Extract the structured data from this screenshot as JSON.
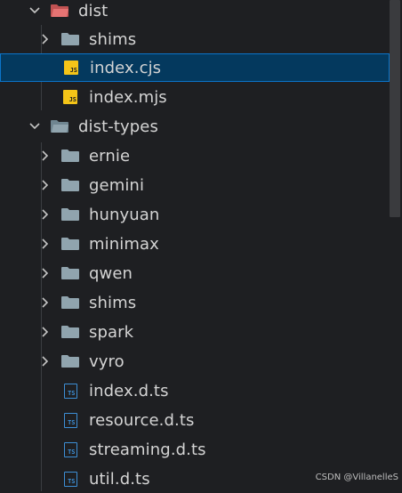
{
  "explorer": {
    "items": [
      {
        "label": "dist",
        "type": "folder",
        "expanded": true,
        "icon": "folder-open-red-icon"
      },
      {
        "label": "shims",
        "type": "folder",
        "expanded": false,
        "icon": "folder-icon"
      },
      {
        "label": "index.cjs",
        "type": "file",
        "icon": "js-file-icon",
        "selected": true,
        "badge": "JS"
      },
      {
        "label": "index.mjs",
        "type": "file",
        "icon": "js-file-icon",
        "badge": "JS"
      },
      {
        "label": "dist-types",
        "type": "folder",
        "expanded": true,
        "icon": "folder-open-icon"
      },
      {
        "label": "ernie",
        "type": "folder",
        "expanded": false,
        "icon": "folder-icon"
      },
      {
        "label": "gemini",
        "type": "folder",
        "expanded": false,
        "icon": "folder-icon"
      },
      {
        "label": "hunyuan",
        "type": "folder",
        "expanded": false,
        "icon": "folder-icon"
      },
      {
        "label": "minimax",
        "type": "folder",
        "expanded": false,
        "icon": "folder-icon"
      },
      {
        "label": "qwen",
        "type": "folder",
        "expanded": false,
        "icon": "folder-icon"
      },
      {
        "label": "shims",
        "type": "folder",
        "expanded": false,
        "icon": "folder-icon"
      },
      {
        "label": "spark",
        "type": "folder",
        "expanded": false,
        "icon": "folder-icon"
      },
      {
        "label": "vyro",
        "type": "folder",
        "expanded": false,
        "icon": "folder-icon"
      },
      {
        "label": "index.d.ts",
        "type": "file",
        "icon": "ts-file-icon",
        "badge": "TS"
      },
      {
        "label": "resource.d.ts",
        "type": "file",
        "icon": "ts-file-icon",
        "badge": "TS"
      },
      {
        "label": "streaming.d.ts",
        "type": "file",
        "icon": "ts-file-icon",
        "badge": "TS"
      },
      {
        "label": "util.d.ts",
        "type": "file",
        "icon": "ts-file-icon",
        "badge": "TS"
      }
    ]
  },
  "watermark": "CSDN @VillanelleS",
  "colors": {
    "background": "#1e1f22",
    "selection_bg": "#04395e",
    "selection_border": "#0b74c9",
    "js_badge": "#f5c518",
    "ts_badge": "#3d8fd6",
    "folder": "#90a4ae",
    "dist_folder": "#e57373"
  }
}
